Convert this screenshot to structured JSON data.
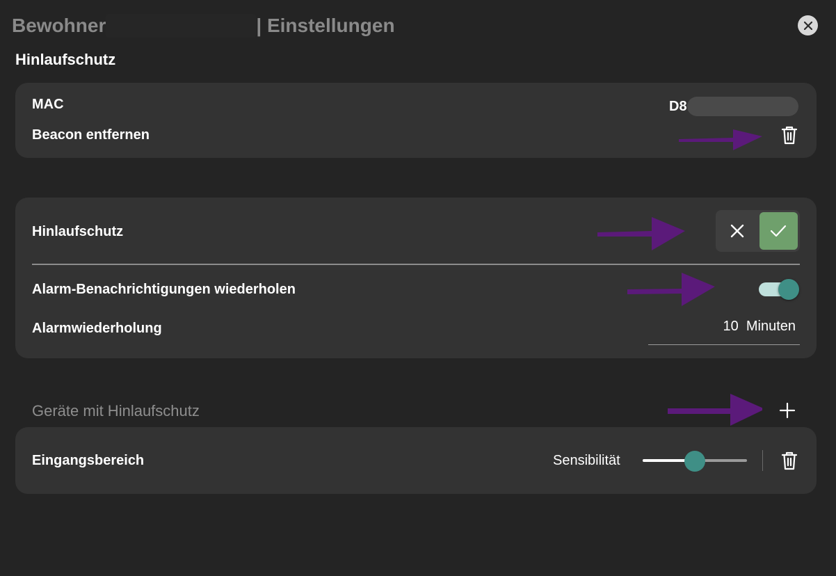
{
  "header": {
    "title_left": "Bewohner",
    "title_right": "| Einstellungen"
  },
  "section": {
    "title": "Hinlaufschutz"
  },
  "beacon_card": {
    "mac_label": "MAC",
    "mac_value": "D8:",
    "remove_label": "Beacon entfernen"
  },
  "settings_card": {
    "hinlaufschutz_label": "Hinlaufschutz",
    "hinlaufschutz_enabled": true,
    "repeat_alarm_label": "Alarm-Benachrichtigungen wiederholen",
    "repeat_alarm_enabled": true,
    "repetition_label": "Alarmwiederholung",
    "repetition_value": "10  Minuten"
  },
  "devices": {
    "header_label": "Geräte mit Hinlaufschutz",
    "items": [
      {
        "name": "Eingangsbereich",
        "sensitivity_label": "Sensibilität",
        "sensitivity_value": 0.5
      }
    ]
  },
  "colors": {
    "background": "#242424",
    "card": "#333333",
    "accent_teal": "#3f8f86",
    "active_green": "#6fa06c",
    "annotation_arrow": "#5b1a7a"
  },
  "icons": [
    "close-icon",
    "trash-icon",
    "x-icon",
    "checkmark-icon",
    "plus-icon",
    "arrow-annotation"
  ]
}
